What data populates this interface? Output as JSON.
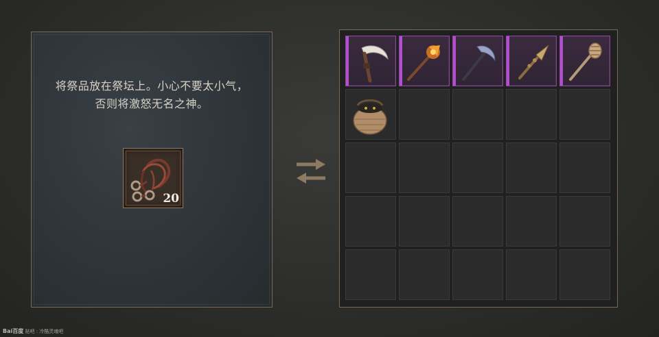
{
  "altar": {
    "prompt_line1": "将祭品放在祭坛上。小心不要太小气，",
    "prompt_line2": "否则将激怒无名之神。",
    "offering": {
      "icon": "shackles-icon",
      "count": "20"
    }
  },
  "swap_icon": "swap-arrows-icon",
  "inventory": {
    "rows": 5,
    "cols": 5,
    "items": [
      {
        "icon": "scythe-icon",
        "rarity": "purple"
      },
      {
        "icon": "flaming-torch-axe-icon",
        "rarity": "purple"
      },
      {
        "icon": "sickle-icon",
        "rarity": "purple"
      },
      {
        "icon": "spear-icon",
        "rarity": "purple"
      },
      {
        "icon": "mace-icon",
        "rarity": "purple"
      },
      {
        "icon": "wicker-basket-icon",
        "rarity": "common"
      }
    ]
  },
  "watermark": {
    "brand": "Bai百度",
    "text": "贴吧 : 冷酷灵魂吧"
  },
  "colors": {
    "rarity_purple": "#b24fd0",
    "frame": "#7a6a55",
    "arrow": "#8c7b62"
  }
}
